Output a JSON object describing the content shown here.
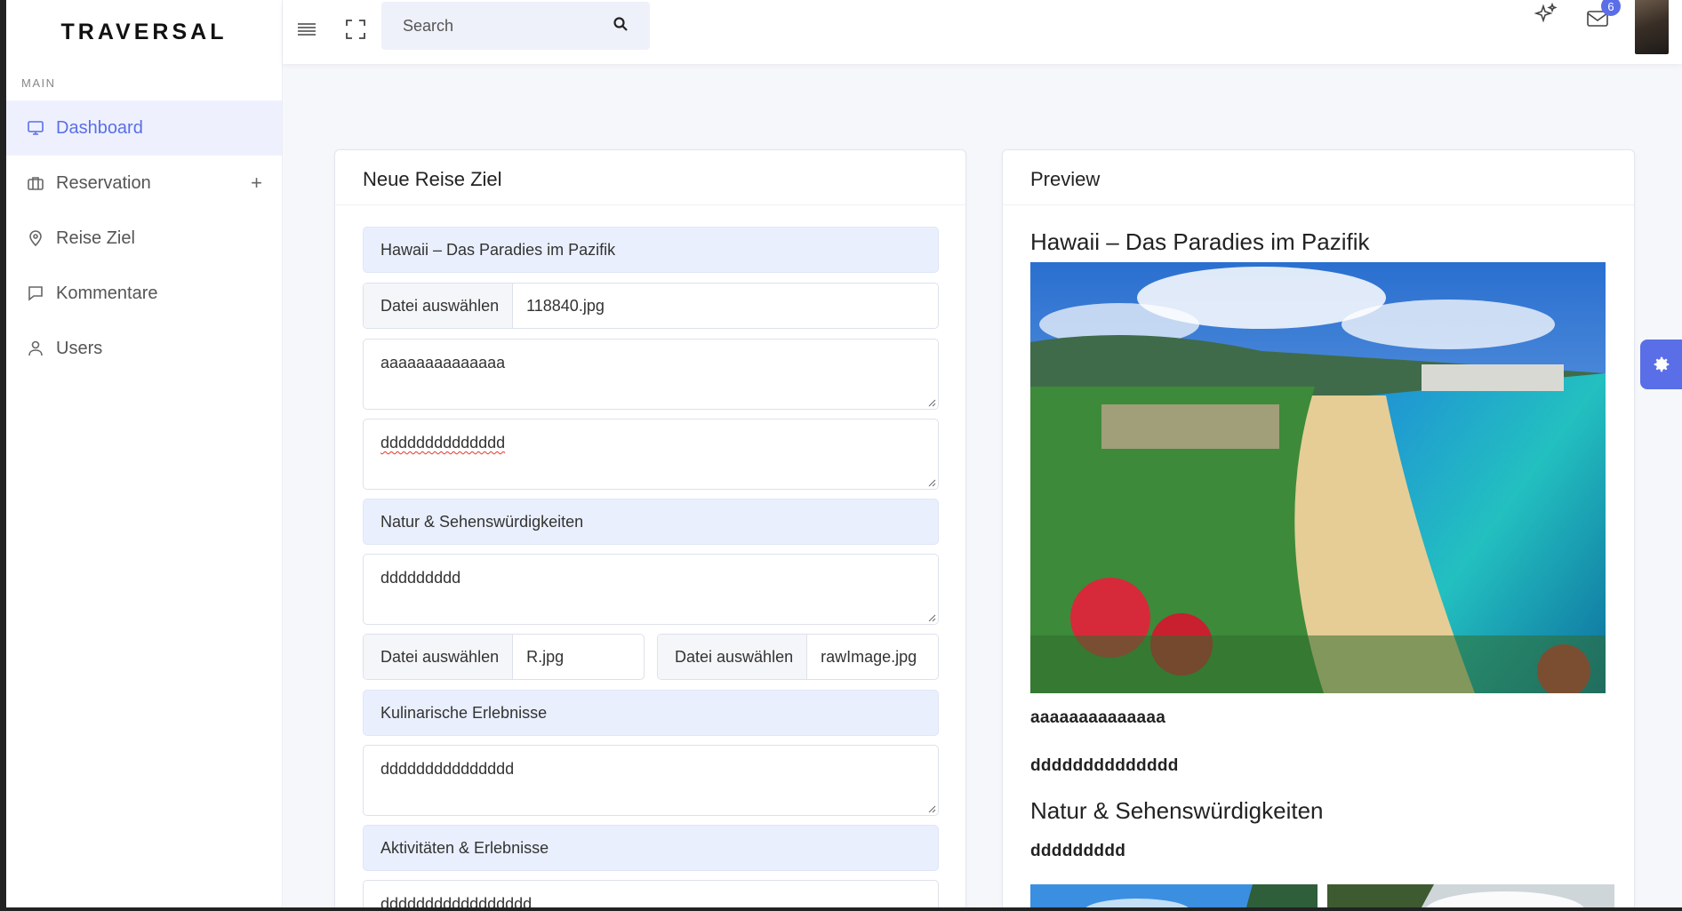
{
  "app": {
    "logo": "TRAVERSAL"
  },
  "sidebar": {
    "section": "MAIN",
    "items": [
      {
        "label": "Dashboard",
        "icon": "monitor-icon",
        "active": true
      },
      {
        "label": "Reservation",
        "icon": "briefcase-icon",
        "has_plus": true
      },
      {
        "label": "Reise Ziel",
        "icon": "map-pin-icon"
      },
      {
        "label": "Kommentare",
        "icon": "comment-icon"
      },
      {
        "label": "Users",
        "icon": "user-icon"
      }
    ]
  },
  "header": {
    "search_placeholder": "Search",
    "mail_badge": "6"
  },
  "form": {
    "title": "Neue Reise Ziel",
    "destination_title": "Hawaii – Das Paradies im Pazifik",
    "file_button": "Datei auswählen",
    "main_file": "118840.jpg",
    "intro_text": "aaaaaaaaaaaaaa",
    "description_text": "dddddddddddddd",
    "section1_title": "Natur & Sehenswürdigkeiten",
    "section1_text": "ddddddddd",
    "section1_file_a": "R.jpg",
    "section1_file_b": "rawImage.jpg",
    "section2_title": "Kulinarische Erlebnisse",
    "section2_text": "ddddddddddddddd",
    "section3_title": "Aktivitäten & Erlebnisse",
    "section3_text": "ddddddddddddddddd"
  },
  "preview": {
    "title": "Preview",
    "heading": "Hawaii – Das Paradies im Pazifik",
    "intro": "aaaaaaaaaaaaaa",
    "description": "dddddddddddddd",
    "section1_heading": "Natur & Sehenswürdigkeiten",
    "section1_text": "ddddddddd"
  },
  "colors": {
    "accent": "#5a6ee8",
    "field_blue": "#e9effd"
  }
}
